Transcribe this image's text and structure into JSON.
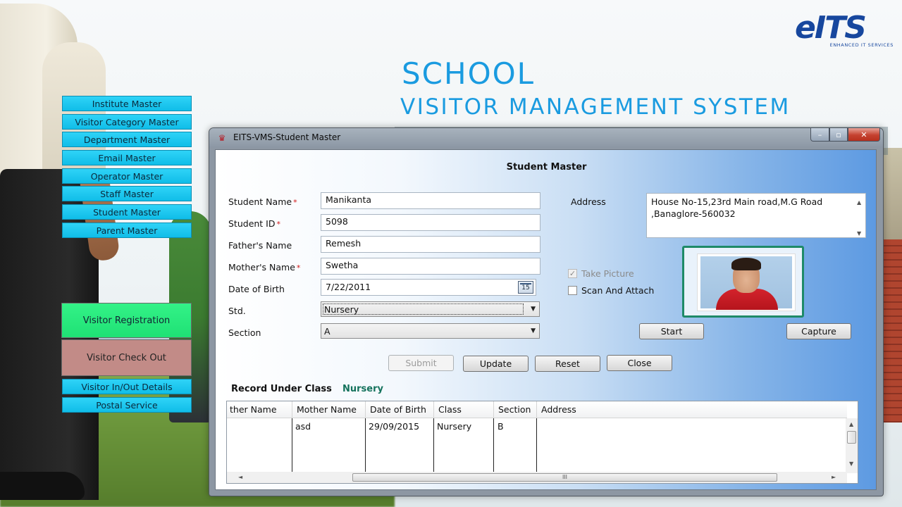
{
  "brand": {
    "logo": "eITS",
    "tagline": "ENHANCED IT SERVICES"
  },
  "title_main": "SCHOOL",
  "title_sub": "VISITOR MANAGEMENT SYSTEM",
  "nav": [
    "Institute Master",
    "Visitor Category Master",
    "Department Master",
    "Email Master",
    "Operator Master",
    "Staff Master",
    "Student Master",
    "Parent Master"
  ],
  "nav_visitor_registration": "Visitor Registration",
  "nav_visitor_checkout": "Visitor Check Out",
  "nav_in_out": "Visitor In/Out Details",
  "nav_postal": "Postal Service",
  "window": {
    "title": "EITS-VMS-Student Master",
    "min_icon": "minimize-icon",
    "max_icon": "maximize-icon",
    "close_icon": "close-icon",
    "min_glyph": "–",
    "max_glyph": "▫",
    "close_glyph": "✕"
  },
  "form": {
    "heading": "Student Master",
    "student_name_label": "Student Name",
    "student_id_label": "Student ID",
    "father_name_label": "Father's Name",
    "mother_name_label": "Mother's Name",
    "dob_label": "Date of Birth",
    "std_label": "Std.",
    "section_label": "Section",
    "address_label": "Address",
    "required_mark": "*",
    "student_name": "Manikanta",
    "student_id": "5098",
    "father_name": "Remesh",
    "mother_name": "Swetha",
    "dob": "7/22/2011",
    "dob_icon_text": "15",
    "std": "Nursery",
    "section": "A",
    "address": "House No-15,23rd Main road,M.G Road ,Banaglore-560032",
    "take_picture": "Take Picture",
    "take_picture_checked": true,
    "scan_attach": "Scan And Attach",
    "scan_attach_checked": false
  },
  "buttons": {
    "start": "Start",
    "capture": "Capture",
    "submit": "Submit",
    "update": "Update",
    "reset": "Reset",
    "close": "Close"
  },
  "records": {
    "label": "Record Under Class",
    "class_name": "Nursery",
    "columns": [
      "ther Name",
      "Mother Name",
      "Date of Birth",
      "Class",
      "Section",
      "Address"
    ],
    "rows": [
      {
        "father": "",
        "mother": "asd",
        "dob": "29/09/2015",
        "class": "Nursery",
        "section": "B",
        "address": ""
      }
    ]
  },
  "scroll": {
    "up": "▲",
    "down": "▼",
    "left": "◄",
    "right": "►",
    "grip": "III"
  },
  "check_glyph": "✓",
  "dropdown_glyph": "▼"
}
